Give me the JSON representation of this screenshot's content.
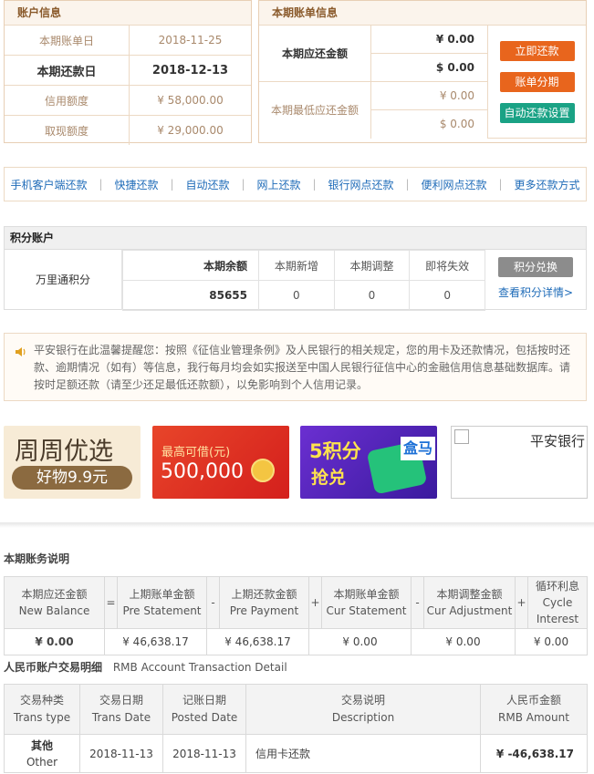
{
  "account_info": {
    "title": "账户信息",
    "rows": [
      {
        "label": "本期账单日",
        "value": "2018-11-25"
      },
      {
        "label": "本期还款日",
        "value": "2018-12-13"
      },
      {
        "label": "信用额度",
        "value": "¥ 58,000.00"
      },
      {
        "label": "取现额度",
        "value": "¥ 29,000.00"
      }
    ]
  },
  "bill_info": {
    "title": "本期账单信息",
    "due_label": "本期应还金额",
    "due_values": [
      "¥ 0.00",
      "$ 0.00"
    ],
    "min_label": "本期最低应还金额",
    "min_values": [
      "¥ 0.00",
      "$ 0.00"
    ],
    "buttons": {
      "pay_now": "立即还款",
      "installment": "账单分期",
      "autopay": "自动还款设置"
    },
    "colors": {
      "orange": "#e8651d",
      "teal": "#1aa285"
    }
  },
  "repay_nav": [
    "手机客户端还款",
    "快捷还款",
    "自动还款",
    "网上还款",
    "银行网点还款",
    "便利网点还款",
    "更多还款方式"
  ],
  "points": {
    "title": "积分账户",
    "account_name": "万里通积分",
    "headers": [
      "本期余额",
      "本期新增",
      "本期调整",
      "即将失效"
    ],
    "values": [
      "85655",
      "0",
      "0",
      "0"
    ],
    "redeem_button": "积分兑换",
    "details_link": "查看积分详情>"
  },
  "notice": {
    "icon": "speaker-icon",
    "text": "平安银行在此温馨提醒您：按照《征信业管理条例》及人民银行的相关规定，您的用卡及还款情况，包括按时还款、逾期情况（如有）等信息，我行每月均会如实报送至中国人民银行征信中心的金融信用信息基础数据库。请按时足额还款（请至少还足最低还款额），以免影响到个人信用记录。"
  },
  "banners": {
    "b1_title": "周周优选",
    "b1_sub": "好物9.9元",
    "b2_line1": "最高可借(元)",
    "b2_line2": "500,000",
    "b3_line1": "5积分",
    "b3_line2": "抢兑",
    "b3_tag": "盒马",
    "b4_alt": "平安银行"
  },
  "statement_summary": {
    "title": "本期账务说明",
    "columns": [
      {
        "cn": "本期应还金额",
        "en": "New Balance",
        "value": "¥ 0.00",
        "bold": true
      },
      {
        "cn": "上期账单金额",
        "en": "Pre Statement",
        "value": "¥ 46,638.17"
      },
      {
        "cn": "上期还款金额",
        "en": "Pre Payment",
        "value": "¥ 46,638.17"
      },
      {
        "cn": "本期账单金额",
        "en": "Cur Statement",
        "value": "¥ 0.00"
      },
      {
        "cn": "本期调整金额",
        "en": "Cur Adjustment",
        "value": "¥ 0.00"
      },
      {
        "cn": "循环利息",
        "en": "Cycle Interest",
        "value": "¥ 0.00"
      }
    ],
    "operators": [
      "=",
      "-",
      "+",
      "-",
      "+"
    ]
  },
  "transactions": {
    "title_cn": "人民币账户交易明细",
    "title_en": "RMB Account Transaction Detail",
    "headers": [
      {
        "cn": "交易种类",
        "en": "Trans type"
      },
      {
        "cn": "交易日期",
        "en": "Trans Date"
      },
      {
        "cn": "记账日期",
        "en": "Posted Date"
      },
      {
        "cn": "交易说明",
        "en": "Description"
      },
      {
        "cn": "人民币金额",
        "en": "RMB Amount"
      }
    ],
    "rows": [
      {
        "type_cn": "其他",
        "type_en": "Other",
        "trans_date": "2018-11-13",
        "posted_date": "2018-11-13",
        "desc": "信用卡还款",
        "amount": "¥ -46,638.17"
      }
    ]
  }
}
